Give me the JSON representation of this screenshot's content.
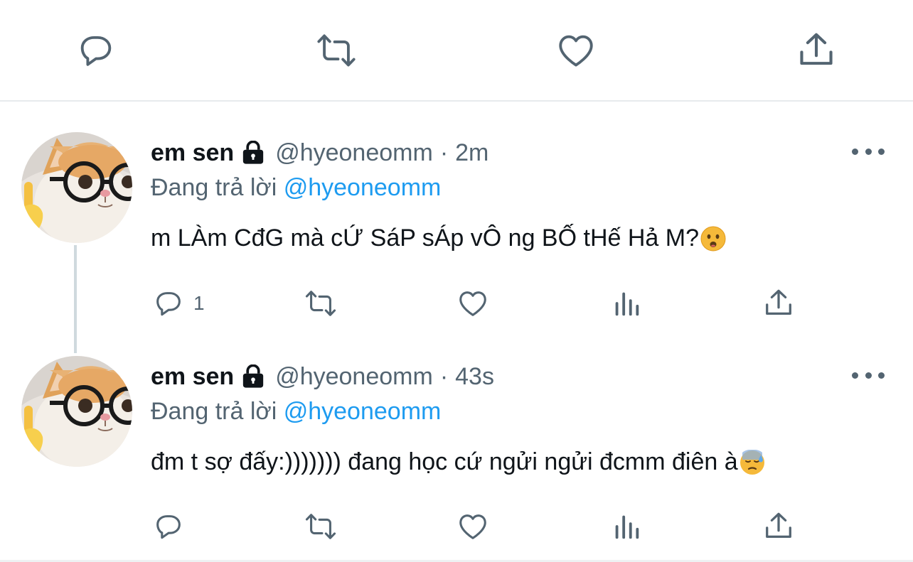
{
  "colors": {
    "icon": "#536471",
    "mention": "#1d9bf0",
    "text": "#0f1419",
    "divider": "#e7eaed"
  },
  "top_actions": {
    "icons": [
      "reply-icon",
      "retweet-icon",
      "like-icon",
      "share-icon"
    ]
  },
  "tweets": [
    {
      "display_name": "em sen",
      "handle": "@hyeoneomm",
      "separator": "·",
      "time": "2m",
      "replying_prefix": "Đang trả lời",
      "replying_to": "@hyeoneomm",
      "text": "m LÀm CđG mà cỨ SáP sÁp vÔ ng BỐ tHế Hả M?",
      "emoji": "frowning-face-open-mouth",
      "reply_count": "1"
    },
    {
      "display_name": "em sen",
      "handle": "@hyeoneomm",
      "separator": "·",
      "time": "43s",
      "replying_prefix": "Đang trả lời",
      "replying_to": "@hyeoneomm",
      "text": "đm t sợ đấy:))))))) đang học cứ ngửi ngửi đcmm điên à",
      "emoji": "downcast-face-with-sweat",
      "reply_count": ""
    }
  ]
}
